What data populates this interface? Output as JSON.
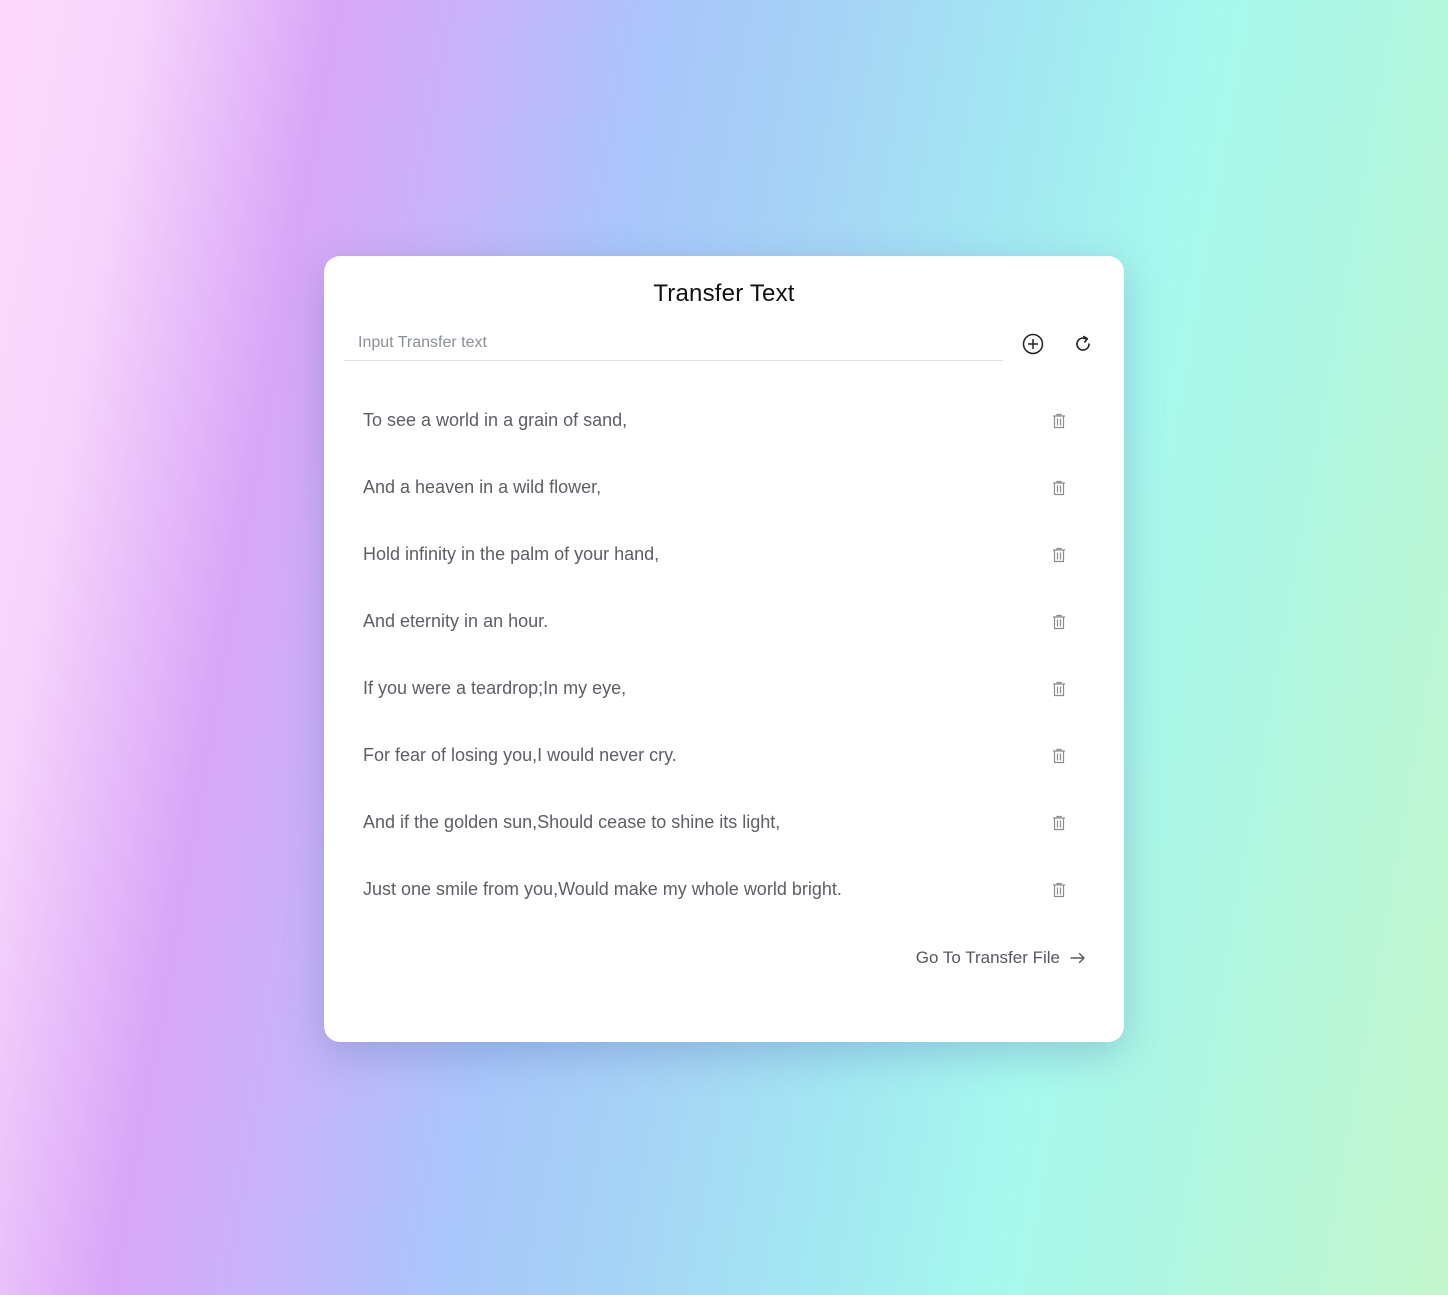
{
  "card": {
    "title": "Transfer Text"
  },
  "input": {
    "placeholder": "Input Transfer text",
    "value": ""
  },
  "toolbar": {
    "add_icon": "circle-plus-icon",
    "refresh_icon": "refresh-icon"
  },
  "items": [
    {
      "text": "To see a world in a grain of sand,",
      "icon": "trash-icon"
    },
    {
      "text": "And a heaven in a wild flower,",
      "icon": "trash-icon"
    },
    {
      "text": "Hold infinity in the palm of your hand,",
      "icon": "trash-icon"
    },
    {
      "text": "And eternity in an hour.",
      "icon": "trash-icon"
    },
    {
      "text": "If you were a teardrop;In my eye,",
      "icon": "trash-icon"
    },
    {
      "text": "For fear of losing you,I would never cry.",
      "icon": "trash-icon"
    },
    {
      "text": "And if the golden sun,Should cease to shine its light,",
      "icon": "trash-icon"
    },
    {
      "text": "Just one smile from you,Would make my whole world bright.",
      "icon": "trash-icon"
    }
  ],
  "footer": {
    "link_label": "Go To Transfer File",
    "link_icon": "arrow-right-icon"
  },
  "colors": {
    "card_background": "#ffffff",
    "text": "#5c5f66",
    "title": "#111111"
  }
}
